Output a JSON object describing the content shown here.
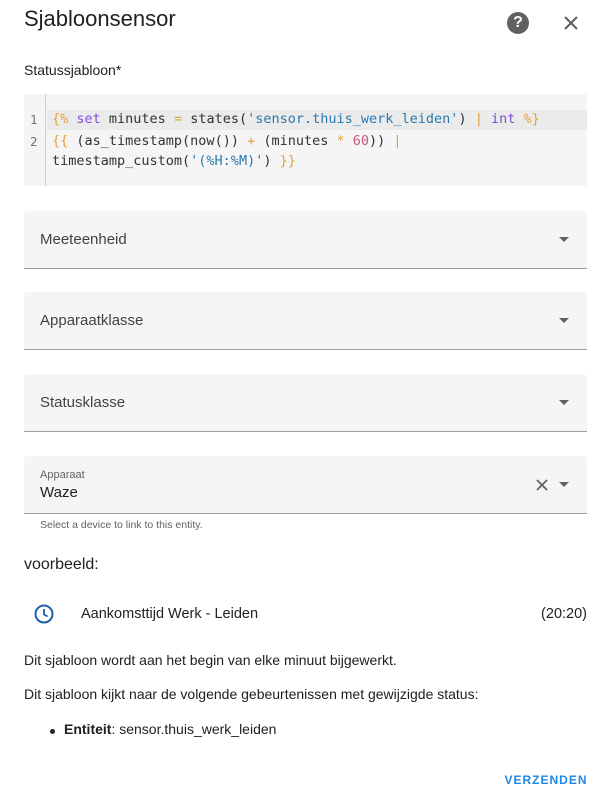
{
  "dialog": {
    "title": "Sjabloonsensor",
    "help_icon": "help-circle-icon",
    "close_icon": "close-icon"
  },
  "template": {
    "label": "Statussjabloon*",
    "line_numbers": [
      "1",
      "2"
    ],
    "lines": {
      "l1": {
        "open": "{%",
        "set": " set",
        "mid": " minutes ",
        "eq": "=",
        "fn": " states(",
        "str": "'sensor.thuis_werk_leiden'",
        "close_paren": ")",
        "pipe": " |",
        "int": " int",
        "end": " %}"
      },
      "l2": {
        "open": "{{",
        "a": " (as_timestamp(now()) ",
        "plus": "+",
        "b": " (minutes ",
        "mul": "*",
        "num": " 60",
        "c": "))",
        "pipe": " |"
      },
      "l3": {
        "a": "timestamp_custom(",
        "str": "'(%H:%M)'",
        "b": ")",
        "end": " }}"
      }
    }
  },
  "fields": {
    "unit": {
      "label": "Meeteenheid"
    },
    "device_class": {
      "label": "Apparaatklasse"
    },
    "state_class": {
      "label": "Statusklasse"
    },
    "device": {
      "label": "Apparaat",
      "value": "Waze",
      "helper": "Select a device to link to this entity."
    }
  },
  "preview": {
    "heading": "voorbeeld:",
    "icon": "clock-outline-icon",
    "entity_name": "Aankomsttijd Werk - Leiden",
    "state": "(20:20)"
  },
  "info": {
    "update_text": "Dit sjabloon wordt aan het begin van elke minuut bijgewerkt.",
    "listen_text": "Dit sjabloon kijkt naar de volgende gebeurtenissen met gewijzigde status:",
    "entity_key": "Entiteit",
    "entity_value": ": sensor.thuis_werk_leiden"
  },
  "actions": {
    "submit_label": "VERZENDEN"
  },
  "colors": {
    "accent": "#1e88e5",
    "field_bg": "#f5f5f5"
  }
}
